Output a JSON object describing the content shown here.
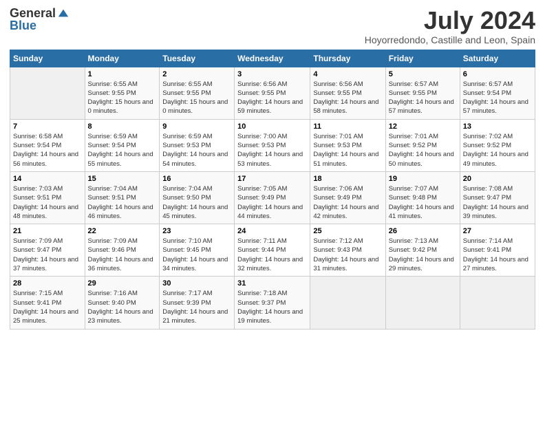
{
  "header": {
    "logo_general": "General",
    "logo_blue": "Blue",
    "month": "July 2024",
    "location": "Hoyorredondo, Castille and Leon, Spain"
  },
  "weekdays": [
    "Sunday",
    "Monday",
    "Tuesday",
    "Wednesday",
    "Thursday",
    "Friday",
    "Saturday"
  ],
  "weeks": [
    [
      {
        "date": "",
        "empty": true
      },
      {
        "date": "1",
        "sunrise": "6:55 AM",
        "sunset": "9:55 PM",
        "daylight": "15 hours and 0 minutes."
      },
      {
        "date": "2",
        "sunrise": "6:55 AM",
        "sunset": "9:55 PM",
        "daylight": "15 hours and 0 minutes."
      },
      {
        "date": "3",
        "sunrise": "6:56 AM",
        "sunset": "9:55 PM",
        "daylight": "14 hours and 59 minutes."
      },
      {
        "date": "4",
        "sunrise": "6:56 AM",
        "sunset": "9:55 PM",
        "daylight": "14 hours and 58 minutes."
      },
      {
        "date": "5",
        "sunrise": "6:57 AM",
        "sunset": "9:55 PM",
        "daylight": "14 hours and 57 minutes."
      },
      {
        "date": "6",
        "sunrise": "6:57 AM",
        "sunset": "9:54 PM",
        "daylight": "14 hours and 57 minutes."
      }
    ],
    [
      {
        "date": "7",
        "sunrise": "6:58 AM",
        "sunset": "9:54 PM",
        "daylight": "14 hours and 56 minutes."
      },
      {
        "date": "8",
        "sunrise": "6:59 AM",
        "sunset": "9:54 PM",
        "daylight": "14 hours and 55 minutes."
      },
      {
        "date": "9",
        "sunrise": "6:59 AM",
        "sunset": "9:53 PM",
        "daylight": "14 hours and 54 minutes."
      },
      {
        "date": "10",
        "sunrise": "7:00 AM",
        "sunset": "9:53 PM",
        "daylight": "14 hours and 53 minutes."
      },
      {
        "date": "11",
        "sunrise": "7:01 AM",
        "sunset": "9:53 PM",
        "daylight": "14 hours and 51 minutes."
      },
      {
        "date": "12",
        "sunrise": "7:01 AM",
        "sunset": "9:52 PM",
        "daylight": "14 hours and 50 minutes."
      },
      {
        "date": "13",
        "sunrise": "7:02 AM",
        "sunset": "9:52 PM",
        "daylight": "14 hours and 49 minutes."
      }
    ],
    [
      {
        "date": "14",
        "sunrise": "7:03 AM",
        "sunset": "9:51 PM",
        "daylight": "14 hours and 48 minutes."
      },
      {
        "date": "15",
        "sunrise": "7:04 AM",
        "sunset": "9:51 PM",
        "daylight": "14 hours and 46 minutes."
      },
      {
        "date": "16",
        "sunrise": "7:04 AM",
        "sunset": "9:50 PM",
        "daylight": "14 hours and 45 minutes."
      },
      {
        "date": "17",
        "sunrise": "7:05 AM",
        "sunset": "9:49 PM",
        "daylight": "14 hours and 44 minutes."
      },
      {
        "date": "18",
        "sunrise": "7:06 AM",
        "sunset": "9:49 PM",
        "daylight": "14 hours and 42 minutes."
      },
      {
        "date": "19",
        "sunrise": "7:07 AM",
        "sunset": "9:48 PM",
        "daylight": "14 hours and 41 minutes."
      },
      {
        "date": "20",
        "sunrise": "7:08 AM",
        "sunset": "9:47 PM",
        "daylight": "14 hours and 39 minutes."
      }
    ],
    [
      {
        "date": "21",
        "sunrise": "7:09 AM",
        "sunset": "9:47 PM",
        "daylight": "14 hours and 37 minutes."
      },
      {
        "date": "22",
        "sunrise": "7:09 AM",
        "sunset": "9:46 PM",
        "daylight": "14 hours and 36 minutes."
      },
      {
        "date": "23",
        "sunrise": "7:10 AM",
        "sunset": "9:45 PM",
        "daylight": "14 hours and 34 minutes."
      },
      {
        "date": "24",
        "sunrise": "7:11 AM",
        "sunset": "9:44 PM",
        "daylight": "14 hours and 32 minutes."
      },
      {
        "date": "25",
        "sunrise": "7:12 AM",
        "sunset": "9:43 PM",
        "daylight": "14 hours and 31 minutes."
      },
      {
        "date": "26",
        "sunrise": "7:13 AM",
        "sunset": "9:42 PM",
        "daylight": "14 hours and 29 minutes."
      },
      {
        "date": "27",
        "sunrise": "7:14 AM",
        "sunset": "9:41 PM",
        "daylight": "14 hours and 27 minutes."
      }
    ],
    [
      {
        "date": "28",
        "sunrise": "7:15 AM",
        "sunset": "9:41 PM",
        "daylight": "14 hours and 25 minutes."
      },
      {
        "date": "29",
        "sunrise": "7:16 AM",
        "sunset": "9:40 PM",
        "daylight": "14 hours and 23 minutes."
      },
      {
        "date": "30",
        "sunrise": "7:17 AM",
        "sunset": "9:39 PM",
        "daylight": "14 hours and 21 minutes."
      },
      {
        "date": "31",
        "sunrise": "7:18 AM",
        "sunset": "9:37 PM",
        "daylight": "14 hours and 19 minutes."
      },
      {
        "date": "",
        "empty": true
      },
      {
        "date": "",
        "empty": true
      },
      {
        "date": "",
        "empty": true
      }
    ]
  ]
}
